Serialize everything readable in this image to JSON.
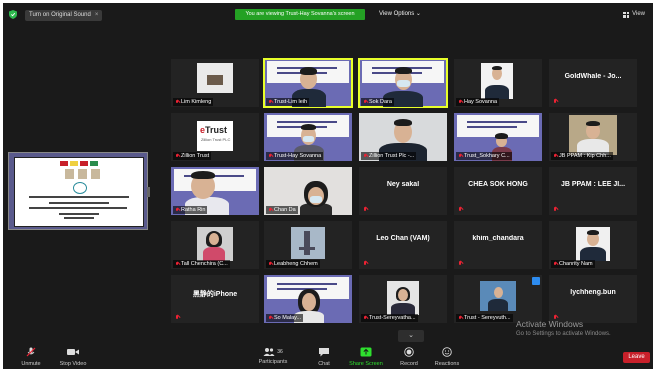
{
  "top_bar": {
    "original_sound_label": "Turn on Original Sound",
    "close_glyph": "×",
    "viewing_banner": "You are viewing Trust-Hay Sovanna's screen",
    "view_options_label": "View Options",
    "view_options_chevron": "⌄",
    "view_label": "View",
    "shield_color": "#2db84d"
  },
  "tiles": [
    {
      "name": "Lim Kimleng",
      "kind": "video"
    },
    {
      "name": "Trust-Lim leih",
      "kind": "video",
      "active": true
    },
    {
      "name": "Sok Dara",
      "kind": "video",
      "active": true
    },
    {
      "name": "Hay Sovanna",
      "kind": "video"
    },
    {
      "name": "",
      "big": "GoldWhale - Jo...",
      "kind": "name"
    },
    {
      "name": "Zillion Trust",
      "kind": "logo",
      "logo_text": "Trust",
      "logo_sub": "Zillion Trust PLC"
    },
    {
      "name": "Trust-Hay Sovanna",
      "kind": "video"
    },
    {
      "name": "Zillion Trust Plc -...",
      "kind": "video"
    },
    {
      "name": "Trust_Sokhary C...",
      "kind": "video"
    },
    {
      "name": "JB PPAM : Kip Chh...",
      "kind": "video"
    },
    {
      "name": "Ratha Rin",
      "kind": "video"
    },
    {
      "name": "Chan Da",
      "kind": "video"
    },
    {
      "name": "",
      "big": "Ney sakal",
      "kind": "name"
    },
    {
      "name": "",
      "big": "CHEA SOK HONG",
      "kind": "name"
    },
    {
      "name": "",
      "big": "JB PPAM : LEE JI...",
      "kind": "name"
    },
    {
      "name": "Tall Chenchira (C...",
      "kind": "video"
    },
    {
      "name": "Leabheng Chhem",
      "kind": "video"
    },
    {
      "name": "",
      "big": "Leo Chan (VAM)",
      "kind": "name"
    },
    {
      "name": "",
      "big": "khim_chandara",
      "kind": "name"
    },
    {
      "name": "Chanrity Nam",
      "kind": "video"
    },
    {
      "name": "",
      "big": "黑静的iPhone",
      "kind": "name"
    },
    {
      "name": "So Malay...",
      "kind": "video"
    },
    {
      "name": "Trust-Sereyvatha...",
      "kind": "video"
    },
    {
      "name": "Trust - Sereyvuth...",
      "kind": "video"
    },
    {
      "name": "",
      "big": "lychheng.bun",
      "kind": "name"
    }
  ],
  "watermark": {
    "title": "Activate Windows",
    "subtitle": "Go to Settings to activate Windows."
  },
  "chevron_glyph": "⌄",
  "bottom_bar": {
    "unmute": "Unmute",
    "stop_video": "Stop Video",
    "participants": "Participants",
    "participants_count": "36",
    "chat": "Chat",
    "share_screen": "Share Screen",
    "record": "Record",
    "reactions": "Reactions",
    "leave": "Leave",
    "caret": "^"
  }
}
